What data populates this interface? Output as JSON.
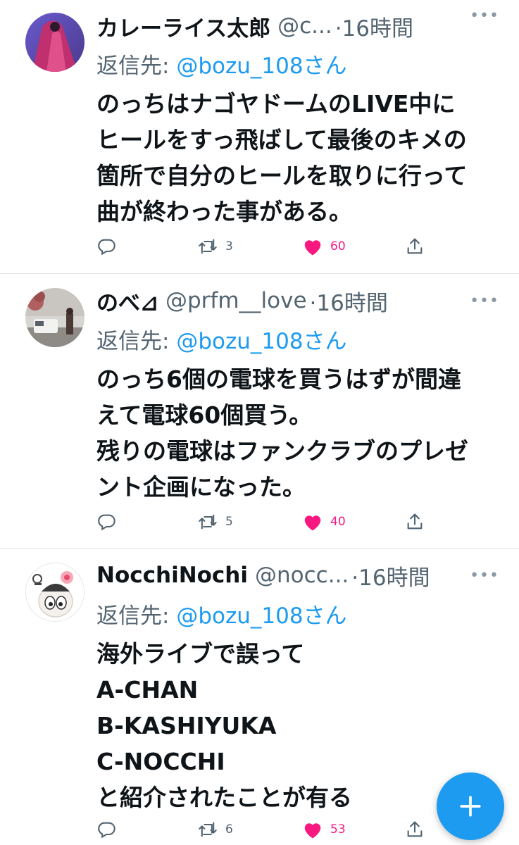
{
  "tweets": [
    {
      "name": "カレーライス太郎",
      "handle": "@c...",
      "time": "·16時間",
      "reply_prefix": "返信先: ",
      "reply_to": "@bozu_108さん",
      "lines": [
        "のっちはナゴヤドームのLIVE中に",
        "ヒールをすっ飛ばして最後のキメの",
        "箇所で自分のヒールを取りに行って",
        "曲が終わった事がある。"
      ],
      "retweets": "3",
      "likes": "60"
    },
    {
      "name": "のべ⊿",
      "handle": "@prfm__love",
      "time": "·16時間",
      "reply_prefix": "返信先: ",
      "reply_to": "@bozu_108さん",
      "lines": [
        "のっち6個の電球を買うはずが間違",
        "えて電球60個買う。",
        "残りの電球はファンクラブのプレゼ",
        "ント企画になった。"
      ],
      "retweets": "5",
      "likes": "40"
    },
    {
      "name": "NocchiNochi",
      "handle": "@nocc...",
      "time": "·16時間",
      "reply_prefix": "返信先: ",
      "reply_to": "@bozu_108さん",
      "lines": [
        "海外ライブで誤って",
        "A-CHAN",
        "B-KASHIYUKA",
        "C-NOCCHI",
        "と紹介されたことが有る"
      ],
      "retweets": "6",
      "likes": "53"
    }
  ],
  "icons": {
    "reply": "speech-bubble",
    "retweet": "retweet-arrows",
    "like": "heart-filled",
    "share": "share-upload",
    "more": "ellipsis",
    "compose": "plus"
  },
  "colors": {
    "link": "#1d9bf0",
    "like": "#f91880",
    "muted": "#536471",
    "fab": "#1d9bf0"
  }
}
